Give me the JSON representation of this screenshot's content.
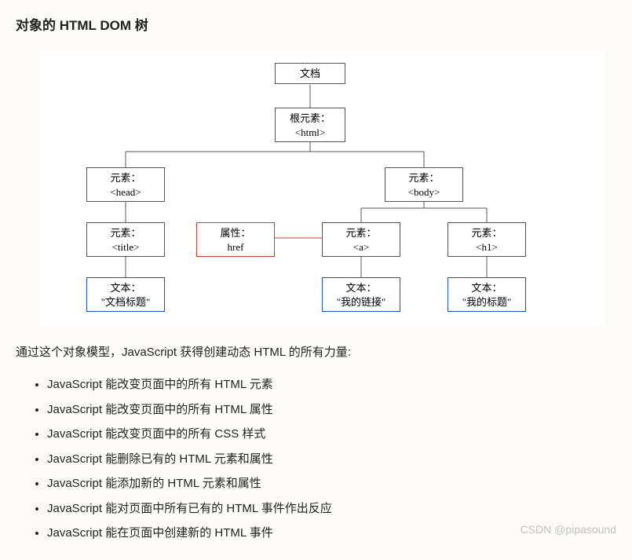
{
  "title": "对象的 HTML DOM 树",
  "tree": {
    "document": {
      "line1": "文档"
    },
    "root": {
      "line1": "根元素：",
      "line2": "<html>"
    },
    "head": {
      "line1": "元素：",
      "line2": "<head>"
    },
    "body": {
      "line1": "元素：",
      "line2": "<body>"
    },
    "title_el": {
      "line1": "元素：",
      "line2": "<title>"
    },
    "attr_href": {
      "line1": "属性：",
      "line2": "href"
    },
    "a_el": {
      "line1": "元素：",
      "line2": "<a>"
    },
    "h1_el": {
      "line1": "元素：",
      "line2": "<h1>"
    },
    "text_title": {
      "line1": "文本：",
      "line2": "\"文档标题\""
    },
    "text_link": {
      "line1": "文本：",
      "line2": "\"我的链接\""
    },
    "text_h1": {
      "line1": "文本：",
      "line2": "\"我的标题\""
    }
  },
  "intro": "通过这个对象模型，JavaScript 获得创建动态 HTML 的所有力量:",
  "capabilities": [
    "JavaScript 能改变页面中的所有 HTML 元素",
    "JavaScript 能改变页面中的所有 HTML 属性",
    "JavaScript 能改变页面中的所有 CSS 样式",
    "JavaScript 能删除已有的 HTML 元素和属性",
    "JavaScript 能添加新的 HTML 元素和属性",
    "JavaScript 能对页面中所有已有的 HTML 事件作出反应",
    "JavaScript 能在页面中创建新的 HTML 事件"
  ],
  "watermark": "CSDN @pipasound"
}
